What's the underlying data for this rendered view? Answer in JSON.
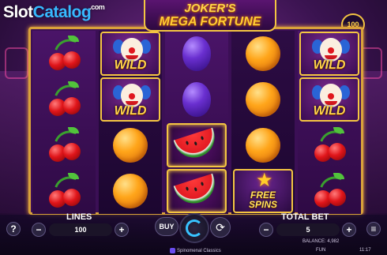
{
  "watermark": {
    "slot": "Slot",
    "catalog": "Catalog",
    "com": ".com"
  },
  "logo": {
    "line1": "JOKER'S",
    "line2": "MEGA FORTUNE"
  },
  "multiplier": {
    "value": "100"
  },
  "reels": [
    [
      "cherry",
      "cherry",
      "cherry",
      "cherry"
    ],
    [
      "wild",
      "wild",
      "orange",
      "orange"
    ],
    [
      "plum",
      "plum",
      "watermelon",
      "watermelon"
    ],
    [
      "orange",
      "orange",
      "orange",
      "free-spins"
    ],
    [
      "wild",
      "wild",
      "cherry",
      "cherry"
    ]
  ],
  "symbols": {
    "wild_label": "WILD",
    "free_spins_line1": "FREE",
    "free_spins_line2": "SPINS"
  },
  "controls": {
    "help_label": "?",
    "lines_label": "LINES",
    "lines_value": "100",
    "minus_label": "−",
    "plus_label": "+",
    "buy_label": "BUY",
    "autoplay_icon": "⟳",
    "total_bet_label": "TOTAL BET",
    "total_bet_value": "5",
    "menu_icon": "≡"
  },
  "footer": {
    "balance": "BALANCE: 4,982",
    "mode": "FUN",
    "provider": "Spinomenal Classics",
    "time": "11:17"
  },
  "colors": {
    "frame_gold": "#d9a23a",
    "background_purple": "#3a1350",
    "spin_accent": "#38c3ff"
  }
}
